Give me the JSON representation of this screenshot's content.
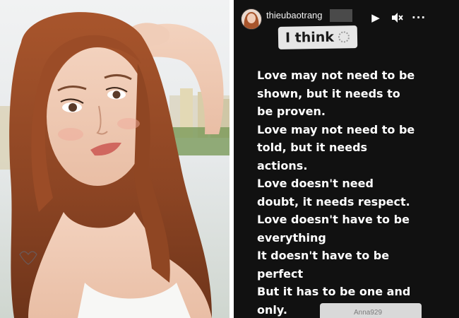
{
  "photo": {
    "alt": "Selfie of a woman with long wavy auburn hair"
  },
  "story": {
    "username": "thieubaotrang",
    "icons": {
      "play": "play-icon",
      "mute": "speaker-muted-icon",
      "more": "more-dots-icon"
    },
    "sticker": {
      "text": "I think",
      "emoji": "thinking-emoji-icon"
    },
    "quote_lines": [
      "Love may not need to be",
      "shown, but it needs to",
      "be proven.",
      "Love may not need to be",
      "told, but it needs",
      "actions.",
      "Love doesn't need",
      "doubt, it needs respect.",
      "Love doesn't have to be",
      "everything",
      "It doesn't have to be",
      "perfect",
      "But it has to be one and",
      "only."
    ],
    "reply": {
      "text": "Anna929"
    }
  },
  "colors": {
    "story_background": "#111111",
    "sticker_background": "#e6e6e6",
    "quote_text": "#ffffff"
  }
}
